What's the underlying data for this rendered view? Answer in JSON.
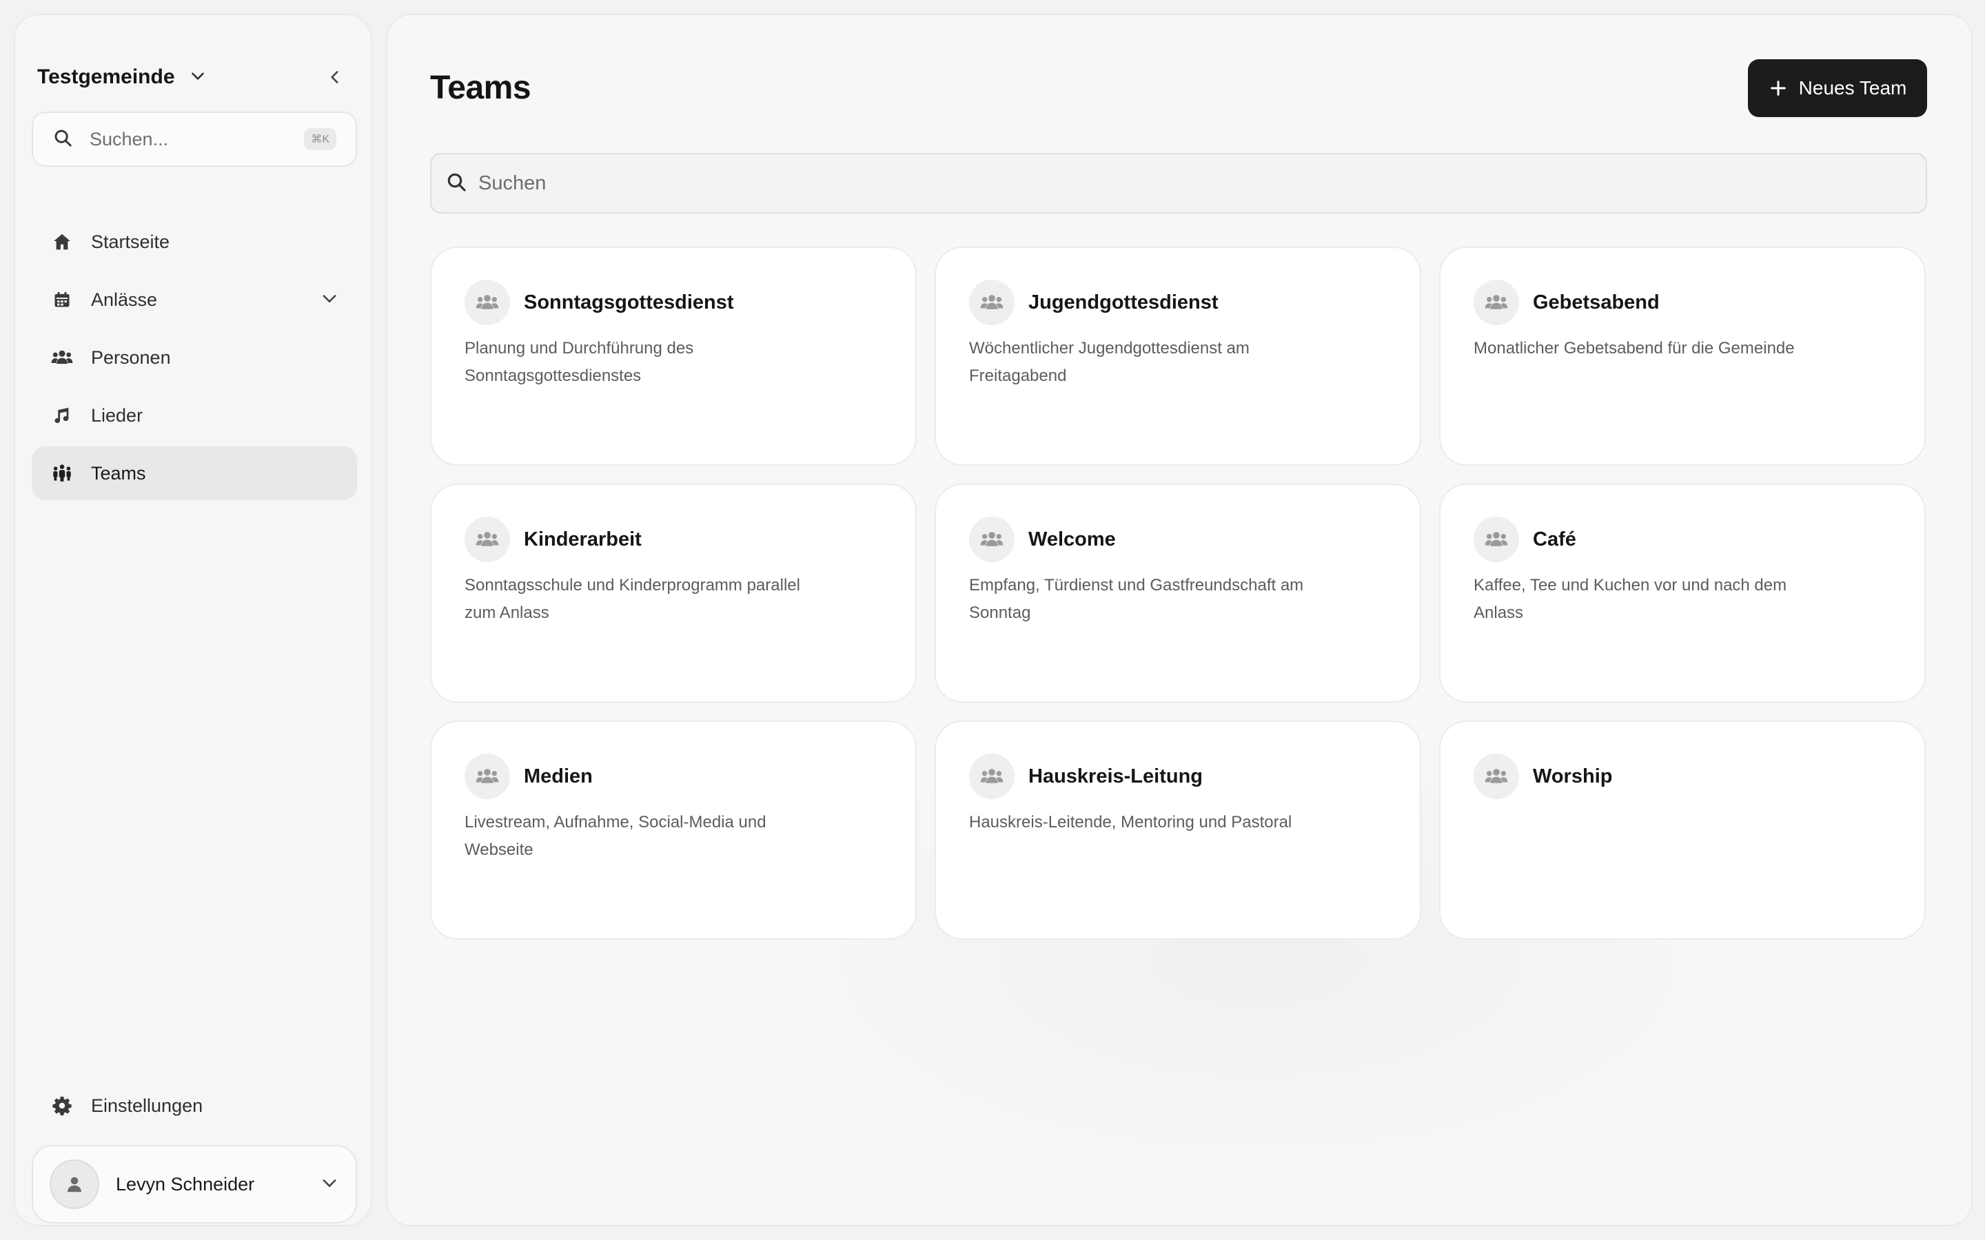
{
  "sidebar": {
    "workspace_name": "Testgemeinde",
    "search": {
      "placeholder": "Suchen...",
      "shortcut": "⌘K"
    },
    "nav": [
      {
        "label": "Startseite",
        "icon": "home-icon"
      },
      {
        "label": "Anlässe",
        "icon": "calendar-icon",
        "expandable": true
      },
      {
        "label": "Personen",
        "icon": "people-icon"
      },
      {
        "label": "Lieder",
        "icon": "music-note-icon"
      },
      {
        "label": "Teams",
        "icon": "teams-icon",
        "active": true
      }
    ],
    "settings_label": "Einstellungen",
    "user_name": "Levyn Schneider"
  },
  "main": {
    "title": "Teams",
    "new_button_label": "Neues Team",
    "search_placeholder": "Suchen",
    "teams": [
      {
        "name": "Sonntagsgottesdienst",
        "description": "Planung und Durchführung des Sonntagsgottesdienstes"
      },
      {
        "name": "Jugendgottesdienst",
        "description": "Wöchentlicher Jugendgottesdienst am Freitagabend"
      },
      {
        "name": "Gebetsabend",
        "description": "Monatlicher Gebetsabend für die Gemeinde"
      },
      {
        "name": "Kinderarbeit",
        "description": "Sonntagsschule und Kinderprogramm parallel zum Anlass"
      },
      {
        "name": "Welcome",
        "description": "Empfang, Türdienst und Gastfreundschaft am Sonntag"
      },
      {
        "name": "Café",
        "description": "Kaffee, Tee und Kuchen vor und nach dem Anlass"
      },
      {
        "name": "Medien",
        "description": "Livestream, Aufnahme, Social-Media und Webseite"
      },
      {
        "name": "Hauskreis-Leitung",
        "description": "Hauskreis-Leitende, Mentoring und Pastoral"
      },
      {
        "name": "Worship",
        "description": ""
      }
    ]
  },
  "colors": {
    "accent_dark": "#1c1c1c",
    "background": "#f3f2f1",
    "card": "#ffffff",
    "active_nav": "#e9e8e7"
  }
}
